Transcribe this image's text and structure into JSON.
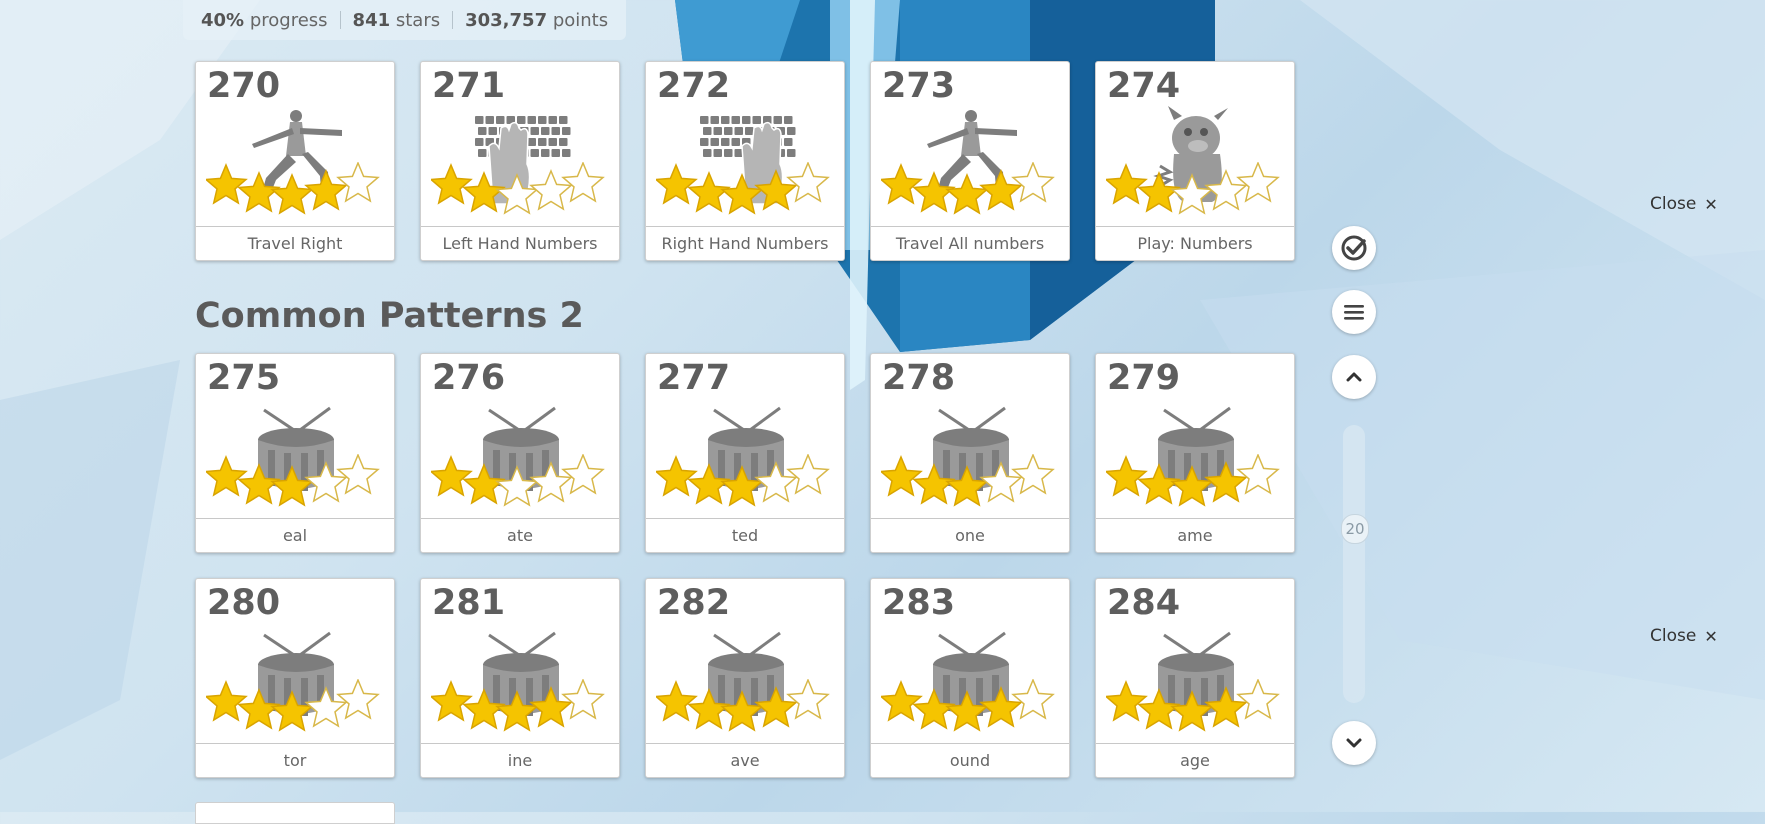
{
  "stats": {
    "progress_value": "40%",
    "progress_label": "progress",
    "stars_value": "841",
    "stars_label": "stars",
    "points_value": "303,757",
    "points_label": "points"
  },
  "section_title": "Common Patterns 2",
  "lessons": [
    {
      "number": "270",
      "label": "Travel Right",
      "icon": "yoga-pose-icon",
      "stars_earned": 4
    },
    {
      "number": "271",
      "label": "Left Hand Numbers",
      "icon": "keyboard-left-hand-icon",
      "stars_earned": 2
    },
    {
      "number": "272",
      "label": "Right Hand Numbers",
      "icon": "keyboard-right-hand-icon",
      "stars_earned": 4
    },
    {
      "number": "273",
      "label": "Travel All numbers",
      "icon": "yoga-pose-icon",
      "stars_earned": 4
    },
    {
      "number": "274",
      "label": "Play: Numbers",
      "icon": "monster-game-icon",
      "stars_earned": 2
    },
    {
      "number": "275",
      "label": "eal",
      "icon": "drum-icon",
      "stars_earned": 3
    },
    {
      "number": "276",
      "label": "ate",
      "icon": "drum-icon",
      "stars_earned": 2
    },
    {
      "number": "277",
      "label": "ted",
      "icon": "drum-icon",
      "stars_earned": 3
    },
    {
      "number": "278",
      "label": "one",
      "icon": "drum-icon",
      "stars_earned": 3
    },
    {
      "number": "279",
      "label": "ame",
      "icon": "drum-icon",
      "stars_earned": 4
    },
    {
      "number": "280",
      "label": "tor",
      "icon": "drum-icon",
      "stars_earned": 3
    },
    {
      "number": "281",
      "label": "ine",
      "icon": "drum-icon",
      "stars_earned": 4
    },
    {
      "number": "282",
      "label": "ave",
      "icon": "drum-icon",
      "stars_earned": 4
    },
    {
      "number": "283",
      "label": "ound",
      "icon": "drum-icon",
      "stars_earned": 4
    },
    {
      "number": "284",
      "label": "age",
      "icon": "drum-icon",
      "stars_earned": 4
    }
  ],
  "sidebar": {
    "buttons": [
      "check-icon",
      "menu-icon",
      "chevron-up-icon",
      "chevron-down-icon"
    ],
    "slider_value": "20"
  },
  "close_label": "Close",
  "colors": {
    "star_fill": "#f5c400",
    "star_empty": "#ffffff",
    "accent_blue": "#1b6fa3",
    "title_text": "#5a5a5a"
  }
}
